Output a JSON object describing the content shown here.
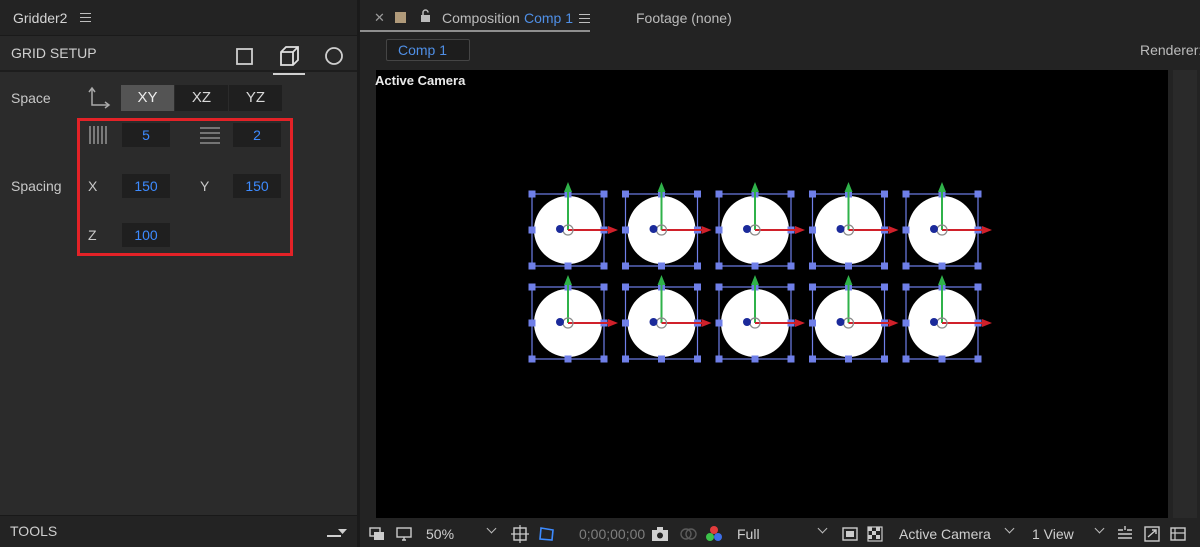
{
  "left_panel": {
    "title": "Gridder2",
    "section_title": "GRID SETUP",
    "mode_icons": [
      "square-icon",
      "cube-icon",
      "circle-icon"
    ],
    "space": {
      "label": "Space",
      "buttons": [
        "XY",
        "XZ",
        "YZ"
      ],
      "active": "XY"
    },
    "counts": {
      "columns": "5",
      "rows": "2"
    },
    "spacing": {
      "label": "Spacing",
      "x_label": "X",
      "x_value": "150",
      "y_label": "Y",
      "y_value": "150",
      "z_label": "Z",
      "z_value": "100"
    },
    "tools": {
      "title": "TOOLS"
    },
    "highlight_color": "#e32227"
  },
  "composition": {
    "tab_prefix": "Composition",
    "comp_name": "Comp 1",
    "footage_tab": "Footage (none)",
    "breadcrumb": "Comp 1",
    "renderer_label": "Renderer:",
    "viewer_label": "Active Camera",
    "grid": {
      "columns": 5,
      "rows": 2
    }
  },
  "viewer_bar": {
    "zoom": "50%",
    "timecode": "0;00;00;00",
    "resolution": "Full",
    "camera": "Active Camera",
    "views": "1 View"
  },
  "colors": {
    "accent_blue": "#3d8bff",
    "link_blue": "#4f8fe6",
    "selection_blue": "#6f7fe8"
  }
}
